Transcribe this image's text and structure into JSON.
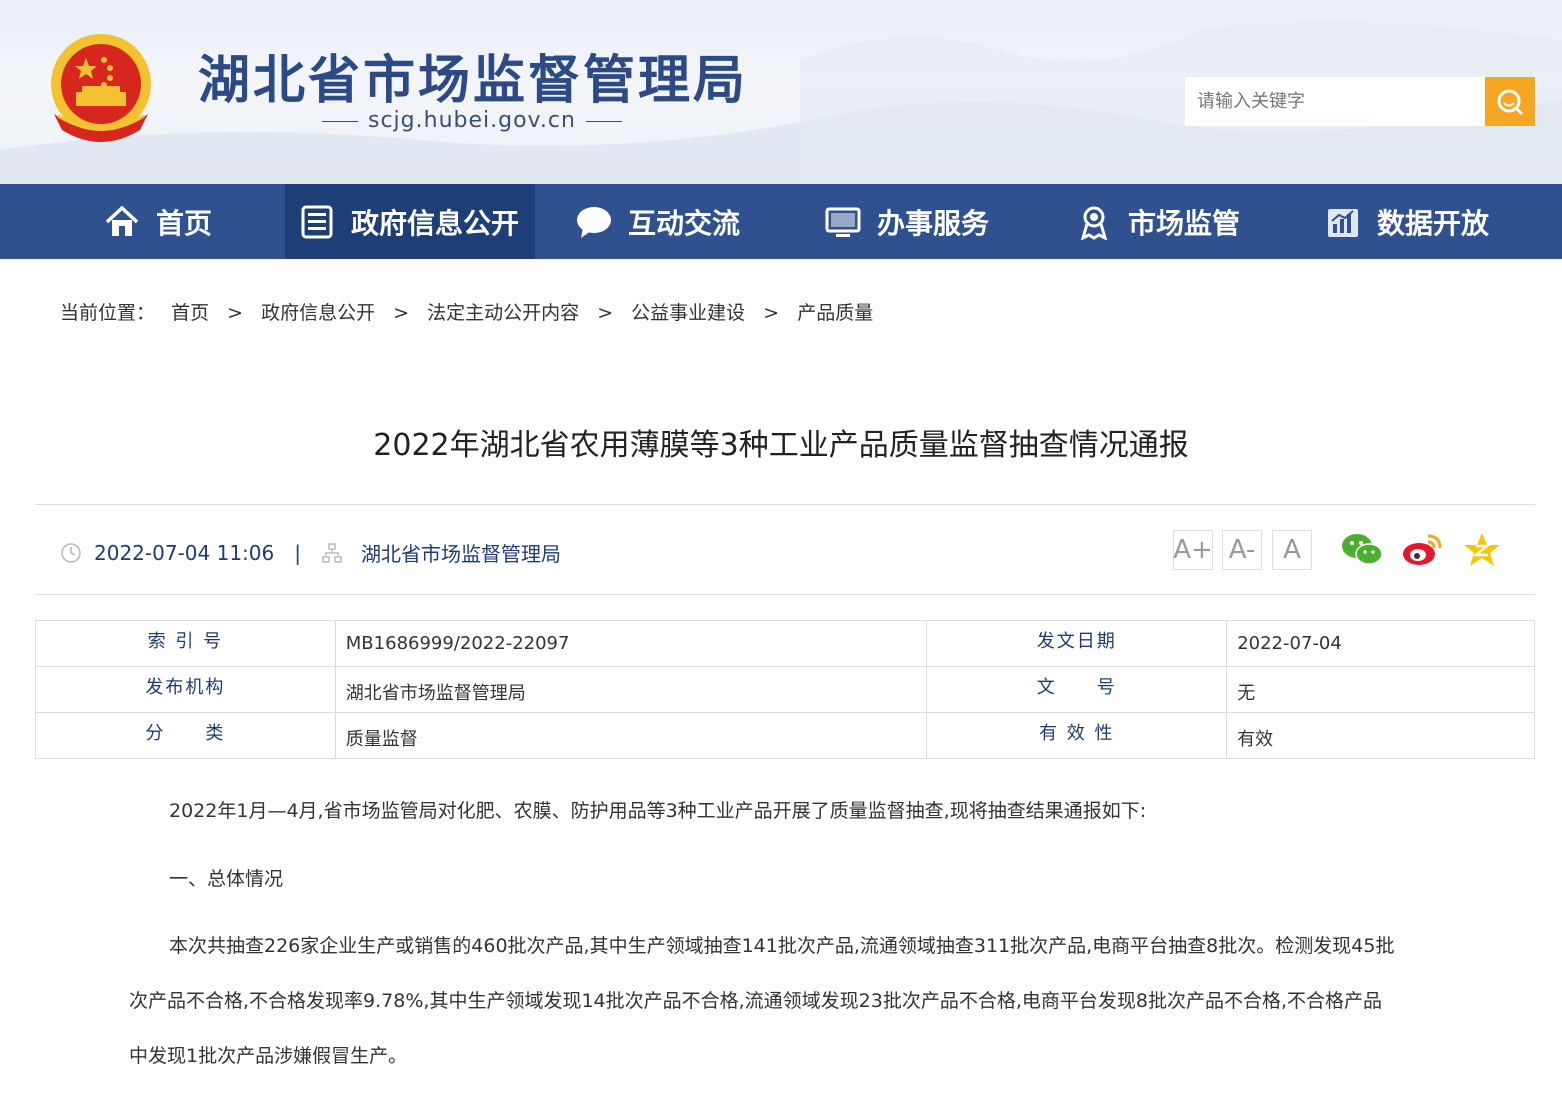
{
  "header": {
    "site_title": "湖北省市场监督管理局",
    "site_domain": "scjg.hubei.gov.cn",
    "search_placeholder": "请输入关键字"
  },
  "nav": {
    "items": [
      {
        "label": "首页",
        "icon": "home-icon"
      },
      {
        "label": "政府信息公开",
        "icon": "document-list-icon"
      },
      {
        "label": "互动交流",
        "icon": "chat-bubble-icon"
      },
      {
        "label": "办事服务",
        "icon": "monitor-icon"
      },
      {
        "label": "市场监管",
        "icon": "badge-icon"
      },
      {
        "label": "数据开放",
        "icon": "chart-icon"
      }
    ],
    "active_index": 1
  },
  "breadcrumb": {
    "prefix": "当前位置：",
    "items": [
      "首页",
      "政府信息公开",
      "法定主动公开内容",
      "公益事业建设",
      "产品质量"
    ],
    "separator": ">"
  },
  "article": {
    "title": "2022年湖北省农用薄膜等3种工业产品质量监督抽查情况通报",
    "datetime": "2022-07-04 11:06",
    "publisher": "湖北省市场监督管理局",
    "font_sizes": [
      "A+",
      "A-",
      "A"
    ]
  },
  "info_table": {
    "rows": [
      {
        "label1": "索 引 号",
        "value1": "MB1686999/2022-22097",
        "label2": "发文日期",
        "value2": "2022-07-04"
      },
      {
        "label1": "发布机构",
        "value1": "湖北省市场监督管理局",
        "label2": "文　　号",
        "value2": "无"
      },
      {
        "label1": "分　　类",
        "value1": "质量监督",
        "label2": "有 效 性",
        "value2": "有效"
      }
    ]
  },
  "body": {
    "p1": "2022年1月—4月,省市场监管局对化肥、农膜、防护用品等3种工业产品开展了质量监督抽查,现将抽查结果通报如下:",
    "h1": "一、总体情况",
    "p2_line1": "本次共抽查226家企业生产或销售的460批次产品,其中生产领域抽查141批次产品,流通领域抽查311批次产品,电商平台抽查8批次。检测发现45批",
    "p2_line2": "次产品不合格,不合格发现率9.78%,其中生产领域发现14批次产品不合格,流通领域发现23批次产品不合格,电商平台发现8批次产品不合格,不合格产品",
    "p2_line3": "中发现1批次产品涉嫌假冒生产。"
  },
  "colors": {
    "nav_bg": "#2f5190",
    "nav_active": "#1e3e78",
    "search_btn": "#f5a623",
    "title_blue": "#2b4a86"
  }
}
